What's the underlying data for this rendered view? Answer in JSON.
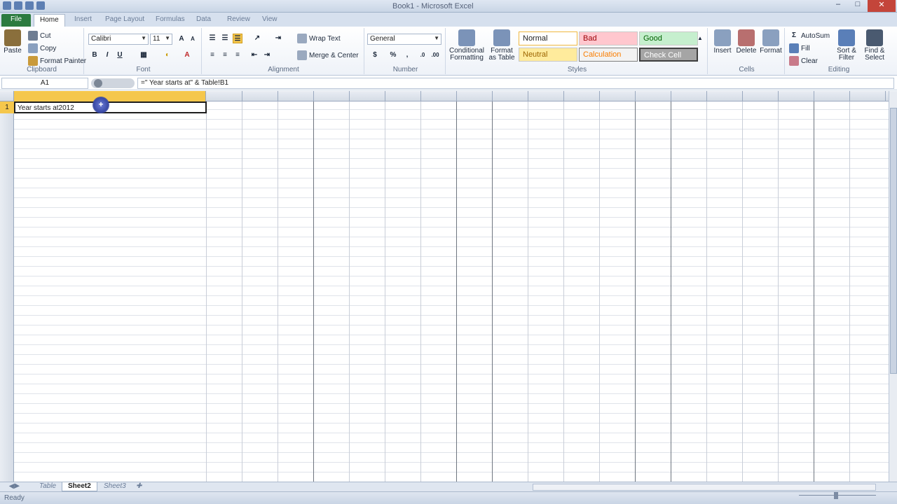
{
  "window": {
    "title": "Book1 - Microsoft Excel"
  },
  "tabs": {
    "file": "File",
    "home": "Home",
    "insert": "Insert",
    "page_layout": "Page Layout",
    "formulas": "Formulas",
    "data": "Data",
    "review": "Review",
    "view": "View"
  },
  "clipboard": {
    "paste": "Paste",
    "cut": "Cut",
    "copy": "Copy",
    "format_painter": "Format Painter",
    "label": "Clipboard"
  },
  "font": {
    "name": "Calibri",
    "size": "11",
    "bold": "B",
    "italic": "I",
    "underline": "U",
    "label": "Font"
  },
  "alignment": {
    "wrap_text": "Wrap Text",
    "merge_center": "Merge & Center",
    "label": "Alignment"
  },
  "number": {
    "format": "General",
    "currency": "$",
    "percent": "%",
    "comma": ",",
    "label": "Number"
  },
  "styles": {
    "conditional_formatting": "Conditional Formatting",
    "format_as_table": "Format as Table",
    "normal": "Normal",
    "bad": "Bad",
    "good": "Good",
    "neutral": "Neutral",
    "calculation": "Calculation",
    "check_cell": "Check Cell",
    "label": "Styles"
  },
  "cells": {
    "insert": "Insert",
    "delete": "Delete",
    "format": "Format",
    "label": "Cells"
  },
  "editing": {
    "autosum": "AutoSum",
    "fill": "Fill",
    "clear": "Clear",
    "sort_filter": "Sort & Filter",
    "find_select": "Find & Select",
    "label": "Editing"
  },
  "formula_bar": {
    "name_box": "A1",
    "formula": "=\" Year starts at\" & Table!B1"
  },
  "sheet": {
    "row1": "1",
    "cell_a1": "Year starts at2012"
  },
  "sheets": {
    "sheet1": "Table",
    "sheet2": "Sheet2",
    "sheet3": "Sheet3"
  },
  "status": {
    "ready": "Ready"
  },
  "colors": {
    "selected_header": "#f5c74c",
    "file_tab": "#2c7b3f"
  }
}
